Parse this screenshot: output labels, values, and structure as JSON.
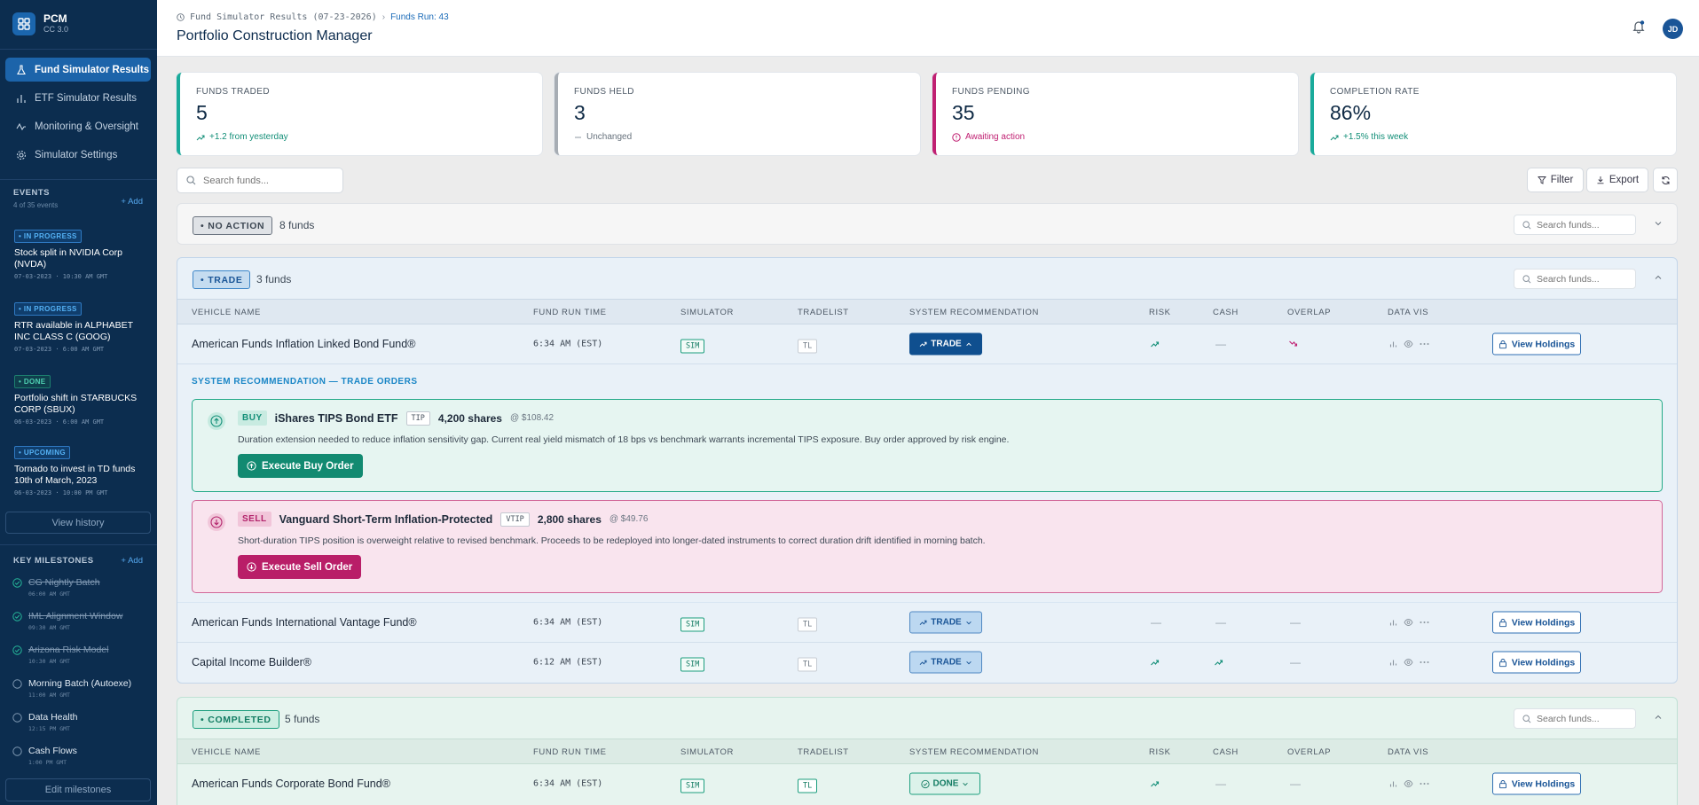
{
  "app": {
    "name": "PCM",
    "version": "CC 3.0"
  },
  "nav": [
    {
      "label": "Fund Simulator Results",
      "icon": "flask-icon",
      "active": true
    },
    {
      "label": "ETF Simulator Results",
      "icon": "bar-chart-icon",
      "active": false
    },
    {
      "label": "Monitoring & Oversight",
      "icon": "activity-icon",
      "active": false
    },
    {
      "label": "Simulator Settings",
      "icon": "gear-icon",
      "active": false
    }
  ],
  "events": {
    "title": "EVENTS",
    "subtitle": "4 of 35 events",
    "add_label": "+ Add",
    "items": [
      {
        "status": "• IN PROGRESS",
        "kind": "prog",
        "title": "Stock split in NVIDIA Corp (NVDA)",
        "time": "07-03-2023 · 10:30 AM GMT"
      },
      {
        "status": "• IN PROGRESS",
        "kind": "prog",
        "title": "RTR available in ALPHABET INC CLASS C (GOOG)",
        "time": "07-03-2023 · 6:00 AM GMT"
      },
      {
        "status": "• DONE",
        "kind": "done",
        "title": "Portfolio shift in STARBUCKS CORP (SBUX)",
        "time": "06-03-2023 · 6:00 AM GMT"
      },
      {
        "status": "• UPCOMING",
        "kind": "prog",
        "title": "Tornado to invest in TD funds 10th of March, 2023",
        "time": "06-03-2023 · 10:00 PM GMT"
      }
    ],
    "history_label": "View history"
  },
  "milestones": {
    "title": "KEY MILESTONES",
    "add_label": "+ Add",
    "items": [
      {
        "name": "CG Nightly Batch",
        "time": "06:00 AM GMT",
        "done": true
      },
      {
        "name": "IML Alignment Window",
        "time": "09:30 AM GMT",
        "done": true
      },
      {
        "name": "Arizona Risk Model",
        "time": "10:30 AM GMT",
        "done": true
      },
      {
        "name": "Morning Batch (Autoexe)",
        "time": "11:00 AM GMT",
        "done": false
      },
      {
        "name": "Data Health",
        "time": "12:15 PM GMT",
        "done": false
      },
      {
        "name": "Cash Flows",
        "time": "1:00 PM GMT",
        "done": false
      }
    ],
    "edit_label": "Edit milestones"
  },
  "header": {
    "breadcrumb": "Fund Simulator Results (07-23-2026)",
    "breadcrumb_link": "Funds Run: 43",
    "title": "Portfolio Construction Manager",
    "avatar": "JD"
  },
  "kpis": [
    {
      "label": "FUNDS TRADED",
      "value": "5",
      "delta": "+1.2 from yesterday",
      "color": "#1aab9b",
      "delta_color": "#138f78",
      "icon": "trend-up-icon"
    },
    {
      "label": "FUNDS HELD",
      "value": "3",
      "delta": "Unchanged",
      "color": "#a7adb4",
      "delta_color": "#66717c",
      "icon": "minus-icon"
    },
    {
      "label": "FUNDS PENDING",
      "value": "35",
      "delta": "Awaiting action",
      "color": "#c02072",
      "delta_color": "#c02072",
      "icon": "alert-circle-icon"
    },
    {
      "label": "COMPLETION RATE",
      "value": "86%",
      "delta": "+1.5% this week",
      "color": "#1aab9b",
      "delta_color": "#138f78",
      "icon": "trend-up-icon"
    }
  ],
  "toolbar": {
    "search_placeholder": "Search funds...",
    "filter": "Filter",
    "export": "Export"
  },
  "columns": [
    "VEHICLE NAME",
    "FUND RUN TIME",
    "SIMULATOR",
    "TRADELIST",
    "SYSTEM RECOMMENDATION",
    "RISK",
    "CASH",
    "OVERLAP",
    "DATA VIS"
  ],
  "groups": {
    "no_action": {
      "badge": "NO ACTION",
      "count": "8 funds",
      "search_placeholder": "Search funds..."
    },
    "trade": {
      "badge": "TRADE",
      "count": "3 funds",
      "search_placeholder": "Search funds...",
      "rows": [
        {
          "name": "American Funds Inflation Linked Bond Fund®",
          "time": "6:34 AM (EST)",
          "sim": "SIM",
          "tl": "TL",
          "rec": "TRADE",
          "rec_style": "active",
          "risk": "up",
          "cash": "—",
          "overlap": "down",
          "action": "View Holdings"
        },
        {
          "name": "American Funds International Vantage Fund®",
          "time": "6:34 AM (EST)",
          "sim": "SIM",
          "tl": "TL",
          "rec": "TRADE",
          "rec_style": "soft",
          "risk": "—",
          "cash": "—",
          "overlap": "—",
          "action": "View Holdings"
        },
        {
          "name": "Capital Income Builder®",
          "time": "6:12 AM (EST)",
          "sim": "SIM",
          "tl": "TL",
          "rec": "TRADE",
          "rec_style": "soft",
          "risk": "up",
          "cash": "up",
          "overlap": "—",
          "action": "View Holdings"
        }
      ]
    },
    "completed": {
      "badge": "COMPLETED",
      "count": "5 funds",
      "search_placeholder": "Search funds...",
      "rows": [
        {
          "name": "American Funds Corporate Bond Fund®",
          "time": "6:34 AM (EST)",
          "sim": "SIM",
          "tl": "TL",
          "rec": "DONE",
          "rec_style": "done",
          "risk": "up",
          "cash": "—",
          "overlap": "—",
          "action": "View Holdings"
        }
      ]
    }
  },
  "orders": {
    "title": "SYSTEM RECOMMENDATION — TRADE ORDERS",
    "buy": {
      "tag": "BUY",
      "name": "iShares TIPS Bond ETF",
      "ticker": "TIP",
      "shares": "4,200 shares",
      "price": "@ $108.42",
      "desc": "Duration extension needed to reduce inflation sensitivity gap. Current real yield mismatch of 18 bps vs benchmark warrants incremental TIPS exposure. Buy order approved by risk engine.",
      "button": "Execute Buy Order"
    },
    "sell": {
      "tag": "SELL",
      "name": "Vanguard Short-Term Inflation-Protected",
      "ticker": "VTIP",
      "shares": "2,800 shares",
      "price": "@ $49.76",
      "desc": "Short-duration TIPS position is overweight relative to revised benchmark. Proceeds to be redeployed into longer-dated instruments to correct duration drift identified in morning batch.",
      "button": "Execute Sell Order"
    }
  }
}
